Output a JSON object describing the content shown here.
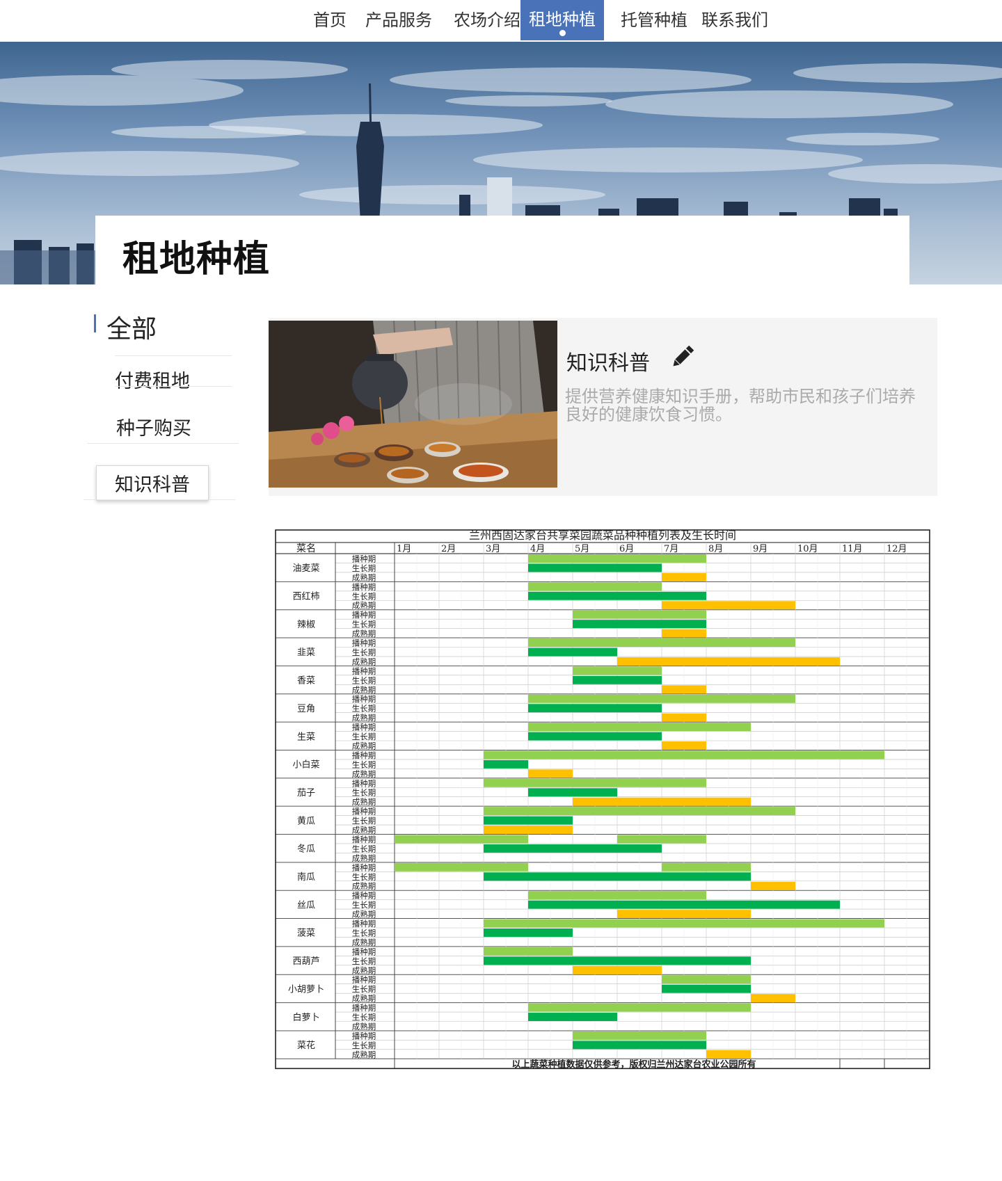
{
  "nav": {
    "items": [
      {
        "label": "首页",
        "active": false
      },
      {
        "label": "产品服务",
        "active": false
      },
      {
        "label": "农场介绍",
        "active": false
      },
      {
        "label": "租地种植",
        "active": true
      },
      {
        "label": "托管种植",
        "active": false
      },
      {
        "label": "联系我们",
        "active": false
      }
    ],
    "accent_color": "#4a72b8"
  },
  "banner": {
    "image": "city-skyline-photo",
    "title": "租地种植"
  },
  "sidebar": {
    "all_label": "全部",
    "items": [
      {
        "label": "付费租地",
        "active": false
      },
      {
        "label": "种子购买",
        "active": false
      },
      {
        "label": "知识科普",
        "active": true
      }
    ]
  },
  "article": {
    "image": "tea-pouring-photo",
    "title": "知识科普",
    "icon": "pencil-icon",
    "description": "提供营养健康知识手册，帮助市民和孩子们培养良好的健康饮食习惯。"
  },
  "chart_data": {
    "type": "table",
    "title": "兰州西固达家台共享菜园蔬菜品种种植列表及生长时间",
    "header_first": "菜名",
    "months": [
      "1月",
      "2月",
      "3月",
      "4月",
      "5月",
      "6月",
      "7月",
      "8月",
      "9月",
      "10月",
      "11月",
      "12月"
    ],
    "phases": [
      "播种期",
      "生长期",
      "成熟期"
    ],
    "phase_colors": {
      "播种期": "#92d050",
      "生长期": "#00b050",
      "成熟期": "#ffc000"
    },
    "footer": "以上蔬菜种植数据仅供参考，版权归兰州达家台农业公园所有",
    "rows": [
      {
        "name": "油麦菜",
        "sow": [
          [
            4,
            7
          ]
        ],
        "grow": [
          [
            4,
            6
          ]
        ],
        "mature": [
          [
            7,
            7
          ]
        ]
      },
      {
        "name": "西红柿",
        "sow": [
          [
            4,
            6
          ]
        ],
        "grow": [
          [
            4,
            7
          ]
        ],
        "mature": [
          [
            7,
            9
          ]
        ]
      },
      {
        "name": "辣椒",
        "sow": [
          [
            5,
            7
          ]
        ],
        "grow": [
          [
            5,
            7
          ]
        ],
        "mature": [
          [
            7,
            7
          ]
        ]
      },
      {
        "name": "韭菜",
        "sow": [
          [
            4,
            9
          ]
        ],
        "grow": [
          [
            4,
            5
          ]
        ],
        "mature": [
          [
            6,
            10
          ]
        ]
      },
      {
        "name": "香菜",
        "sow": [
          [
            5,
            6
          ]
        ],
        "grow": [
          [
            5,
            6
          ]
        ],
        "mature": [
          [
            7,
            7
          ]
        ]
      },
      {
        "name": "豆角",
        "sow": [
          [
            4,
            9
          ]
        ],
        "grow": [
          [
            4,
            6
          ]
        ],
        "mature": [
          [
            7,
            7
          ]
        ]
      },
      {
        "name": "生菜",
        "sow": [
          [
            4,
            8
          ]
        ],
        "grow": [
          [
            4,
            6
          ]
        ],
        "mature": [
          [
            7,
            7
          ]
        ]
      },
      {
        "name": "小白菜",
        "sow": [
          [
            3,
            11
          ]
        ],
        "grow": [
          [
            3,
            3
          ]
        ],
        "mature": [
          [
            4,
            4
          ]
        ]
      },
      {
        "name": "茄子",
        "sow": [
          [
            3,
            7
          ]
        ],
        "grow": [
          [
            4,
            5
          ]
        ],
        "mature": [
          [
            5,
            8
          ]
        ]
      },
      {
        "name": "黄瓜",
        "sow": [
          [
            3,
            9
          ]
        ],
        "grow": [
          [
            3,
            4
          ]
        ],
        "mature": [
          [
            3,
            4
          ]
        ]
      },
      {
        "name": "冬瓜",
        "sow": [
          [
            1,
            3
          ],
          [
            6,
            7
          ]
        ],
        "grow": [
          [
            3,
            6
          ]
        ],
        "mature": []
      },
      {
        "name": "南瓜",
        "sow": [
          [
            1,
            3
          ],
          [
            7,
            8
          ]
        ],
        "grow": [
          [
            3,
            8
          ]
        ],
        "mature": [
          [
            9,
            9
          ]
        ]
      },
      {
        "name": "丝瓜",
        "sow": [
          [
            4,
            7
          ]
        ],
        "grow": [
          [
            4,
            10
          ]
        ],
        "mature": [
          [
            6,
            8
          ]
        ]
      },
      {
        "name": "菠菜",
        "sow": [
          [
            3,
            11
          ]
        ],
        "grow": [
          [
            3,
            4
          ]
        ],
        "mature": []
      },
      {
        "name": "西葫芦",
        "sow": [
          [
            3,
            4
          ]
        ],
        "grow": [
          [
            3,
            8
          ]
        ],
        "mature": [
          [
            5,
            6
          ]
        ]
      },
      {
        "name": "小胡萝卜",
        "sow": [
          [
            7,
            8
          ]
        ],
        "grow": [
          [
            7,
            8
          ]
        ],
        "mature": [
          [
            9,
            9
          ]
        ]
      },
      {
        "name": "白萝卜",
        "sow": [
          [
            4,
            8
          ]
        ],
        "grow": [
          [
            4,
            5
          ]
        ],
        "mature": []
      },
      {
        "name": "菜花",
        "sow": [
          [
            5,
            7
          ]
        ],
        "grow": [
          [
            5,
            7
          ]
        ],
        "mature": [
          [
            8,
            8
          ]
        ]
      }
    ]
  }
}
